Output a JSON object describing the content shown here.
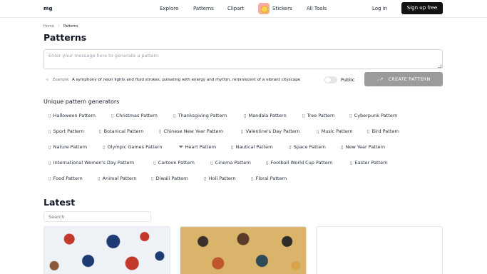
{
  "nav": {
    "logo": "mg",
    "links": [
      "Explore",
      "Patterns",
      "Clipart",
      "Stickers",
      "All Tools"
    ],
    "login": "Log in",
    "signup": "Sign up free"
  },
  "breadcrumb": {
    "home": "Home",
    "separator": "›",
    "current": "Patterns"
  },
  "page_title": "Patterns",
  "prompt": {
    "placeholder": "Enter your message here to generate a pattern",
    "example_label": "Example:",
    "example_text": "A symphony of neon lights and fluid strokes, pulsating with energy and rhythm, reminiscent of a vibrant cityscape",
    "public_label": "Public",
    "create_label": "CREATE PATTERN"
  },
  "generators": {
    "title": "Unique pattern generators",
    "rows": [
      [
        "Halloween Pattern",
        "Christmas Pattern",
        "Thanksgiving Pattern",
        "Mandala Pattern",
        "Tree Pattern",
        "Cyberpunk Pattern"
      ],
      [
        "Sport Pattern",
        "Botanical Pattern",
        "Chinese New Year Pattern",
        "Valentine's Day Pattern",
        "Music Pattern",
        "Bird Pattern"
      ],
      [
        "Nature Pattern",
        "Olympic Games Pattern",
        "Heart Pattern",
        "Nautical Pattern",
        "Space Pattern",
        "New Year Pattern"
      ],
      [
        "International Women's Day Pattern",
        "Cartoon Pattern",
        "Cinema Pattern",
        "Football World Cup Pattern",
        "Easter Pattern"
      ],
      [
        "Food Pattern",
        "Animal Pattern",
        "Diwali Pattern",
        "Holi Pattern",
        "Floral Pattern"
      ]
    ],
    "glyphs": [
      [
        "▯",
        "▯",
        "▯",
        "▯",
        "▯",
        "▯"
      ],
      [
        "▯",
        "▯",
        "▯",
        "▯",
        "▯",
        "▯"
      ],
      [
        "▯",
        "▯",
        "❤",
        "▯",
        "▯",
        "▯"
      ],
      [
        "▯",
        "▯",
        "▯",
        "▯",
        "▯"
      ],
      [
        "▯",
        "▯",
        "▯",
        "▯",
        "▯"
      ]
    ]
  },
  "latest": {
    "title": "Latest",
    "search_placeholder": "Search"
  },
  "colors": {
    "signup_bg": "#111111",
    "create_bg": "#9b9b9b"
  }
}
